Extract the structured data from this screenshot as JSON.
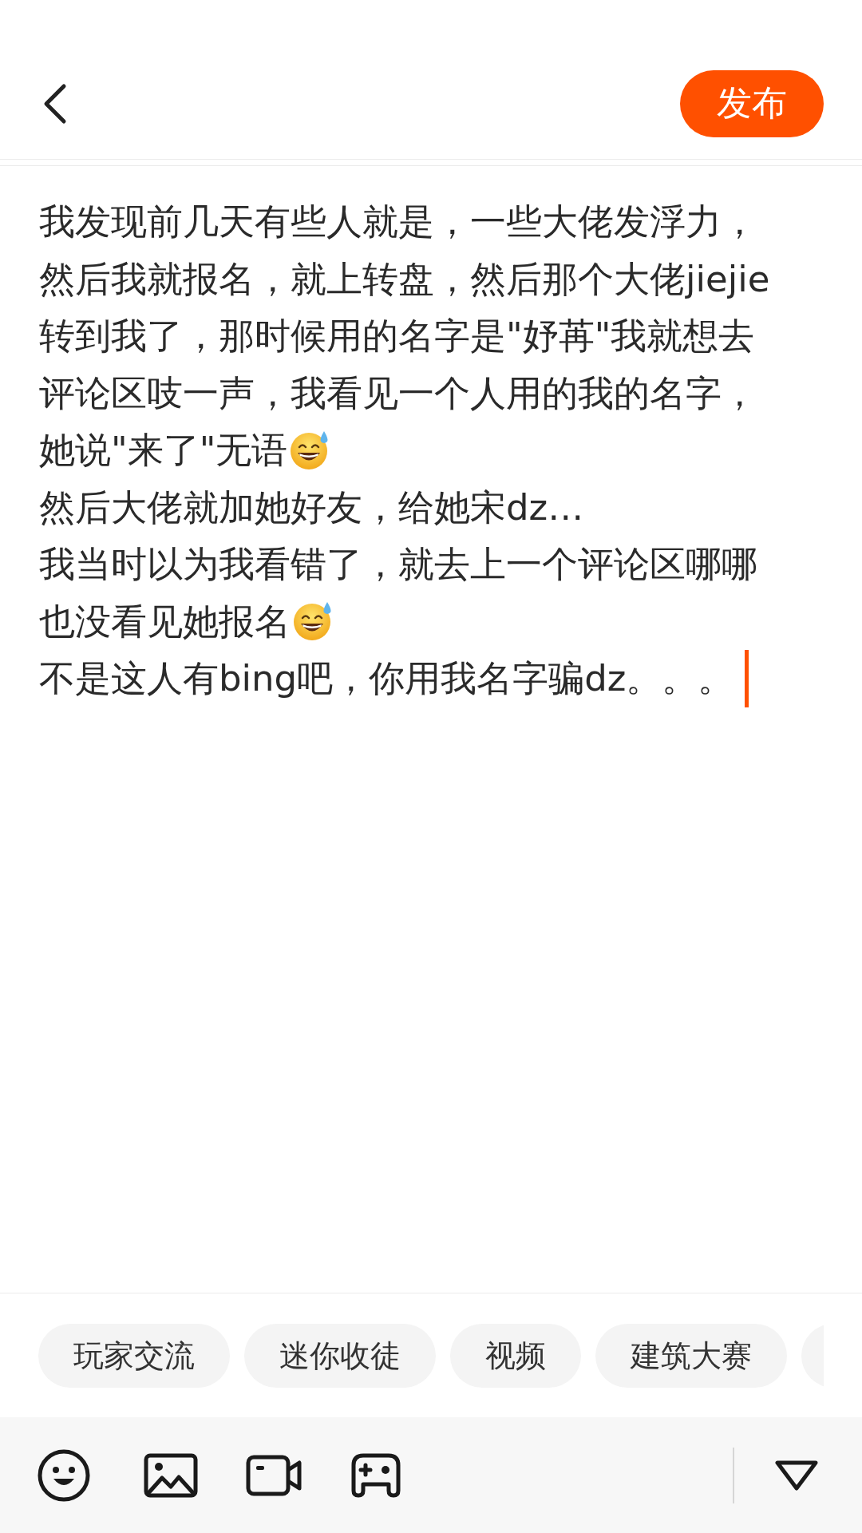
{
  "header": {
    "publish_button": "发布"
  },
  "editor": {
    "cursor": true,
    "lines": [
      {
        "text": "我发现前几天有些人就是，一些大佬发浮力，",
        "emoji": false
      },
      {
        "text": "然后我就报名，就上转盘，然后那个大佬jiejie",
        "emoji": false
      },
      {
        "text": "转到我了，那时候用的名字是\"妤苒\"我就想去",
        "emoji": false
      },
      {
        "text": "评论区吱一声，我看见一个人用的我的名字，",
        "emoji": false
      },
      {
        "text": "她说\"来了\"无语",
        "emoji": true
      },
      {
        "text": "然后大佬就加她好友，给她宋dz…",
        "emoji": false
      },
      {
        "text": "我当时以为我看错了，就去上一个评论区哪哪",
        "emoji": false
      },
      {
        "text": "也没看见她报名",
        "emoji": true
      },
      {
        "text": "不是这人有bing吧，你用我名字骗dz。。。",
        "emoji": false
      }
    ]
  },
  "topics": [
    {
      "label": "玩家交流"
    },
    {
      "label": "迷你收徒"
    },
    {
      "label": "视频"
    },
    {
      "label": "建筑大赛"
    }
  ]
}
